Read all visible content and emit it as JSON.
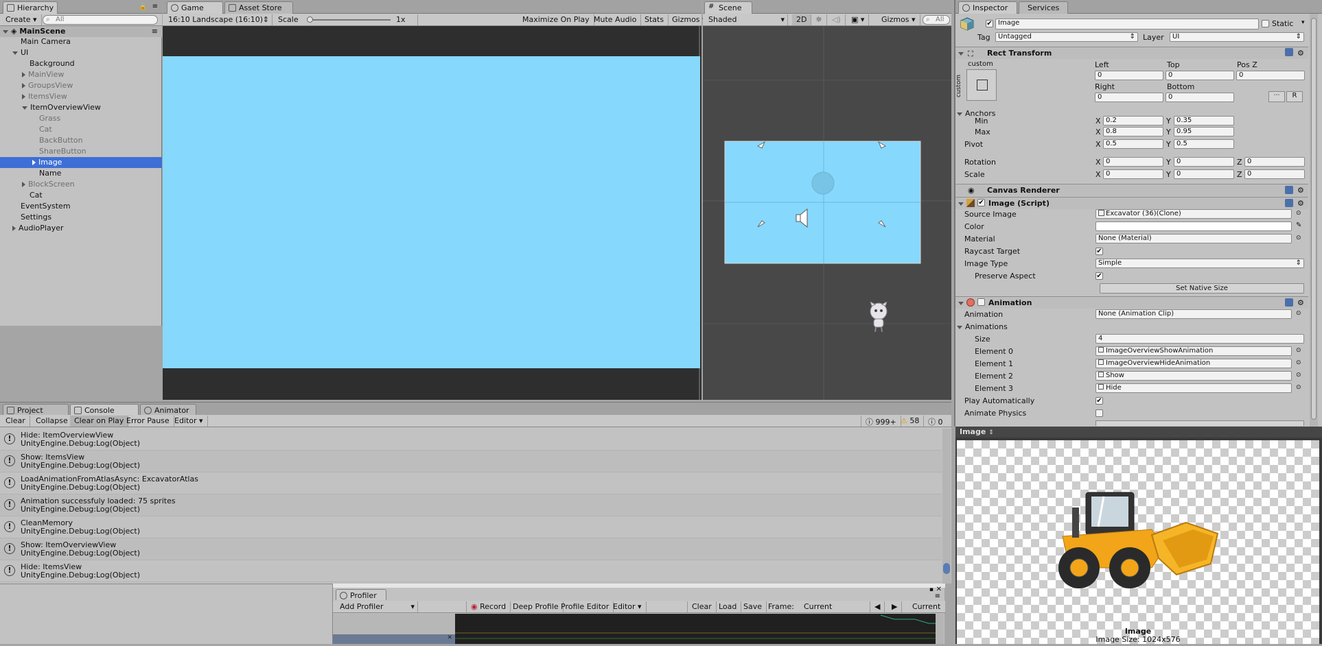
{
  "hierarchy": {
    "tab": "Hierarchy",
    "create_label": "Create",
    "search_placeholder": "All",
    "scene": "MainScene",
    "items": [
      {
        "label": "Main Camera"
      },
      {
        "label": "UI"
      },
      {
        "label": "Background"
      },
      {
        "label": "MainView"
      },
      {
        "label": "GroupsView"
      },
      {
        "label": "ItemsView"
      },
      {
        "label": "ItemOverviewView"
      },
      {
        "label": "Grass"
      },
      {
        "label": "Cat"
      },
      {
        "label": "BackButton"
      },
      {
        "label": "ShareButton"
      },
      {
        "label": "Image"
      },
      {
        "label": "Name"
      },
      {
        "label": "BlockScreen"
      },
      {
        "label": "Cat"
      },
      {
        "label": "EventSystem"
      },
      {
        "label": "Settings"
      },
      {
        "label": "AudioPlayer"
      }
    ]
  },
  "game": {
    "tab_game": "Game",
    "tab_asset_store": "Asset Store",
    "resolution": "16:10 Landscape (16:10)",
    "scale_label": "Scale",
    "scale_value": "1x",
    "maximize": "Maximize On Play",
    "mute": "Mute Audio",
    "stats": "Stats",
    "gizmos": "Gizmos",
    "viewport_color": "#87d8fd"
  },
  "scene": {
    "tab": "Scene",
    "shading": "Shaded",
    "mode_2d": "2D",
    "gizmos": "Gizmos",
    "search_placeholder": "All"
  },
  "inspector": {
    "tab": "Inspector",
    "tab_services": "Services",
    "object_name": "Image",
    "static_label": "Static",
    "tag_label": "Tag",
    "tag_value": "Untagged",
    "layer_label": "Layer",
    "layer_value": "UI",
    "rect_transform": {
      "title": "Rect Transform",
      "anchor_preset": "custom",
      "anchor_side": "custom",
      "left_label": "Left",
      "left": "0",
      "top_label": "Top",
      "top": "0",
      "posz_label": "Pos Z",
      "posz": "0",
      "right_label": "Right",
      "right": "0",
      "bottom_label": "Bottom",
      "bottom": "0",
      "r_button": "R",
      "anchors_label": "Anchors",
      "min_label": "Min",
      "min_x": "0.2",
      "min_y": "0.35",
      "max_label": "Max",
      "max_x": "0.8",
      "max_y": "0.95",
      "pivot_label": "Pivot",
      "pivot_x": "0.5",
      "pivot_y": "0.5",
      "rotation_label": "Rotation",
      "rot_x": "0",
      "rot_y": "0",
      "rot_z": "0",
      "scale_label": "Scale",
      "scale_x": "0",
      "scale_y": "0",
      "scale_z": "0",
      "x": "X",
      "y": "Y",
      "z": "Z"
    },
    "canvas_renderer": "Canvas Renderer",
    "image_script": {
      "title": "Image (Script)",
      "source_label": "Source Image",
      "source": "Excavator (36)(Clone)",
      "color_label": "Color",
      "material_label": "Material",
      "material": "None (Material)",
      "raycast_label": "Raycast Target",
      "type_label": "Image Type",
      "type": "Simple",
      "preserve_label": "Preserve Aspect",
      "native_button": "Set Native Size"
    },
    "animation": {
      "title": "Animation",
      "anim_label": "Animation",
      "anim_value": "None (Animation Clip)",
      "anims_label": "Animations",
      "size_label": "Size",
      "size": "4",
      "elements": [
        {
          "label": "Element 0",
          "value": "ImageOverviewShowAnimation"
        },
        {
          "label": "Element 1",
          "value": "ImageOverviewHideAnimation"
        },
        {
          "label": "Element 2",
          "value": "Show"
        },
        {
          "label": "Element 3",
          "value": "Hide"
        }
      ],
      "play_auto_label": "Play Automatically",
      "physics_label": "Animate Physics"
    }
  },
  "preview": {
    "title": "Image",
    "caption": "Image",
    "size": "Image Size: 1024x576"
  },
  "console": {
    "tab_project": "Project",
    "tab_console": "Console",
    "tab_animator": "Animator",
    "clear": "Clear",
    "collapse": "Collapse",
    "clear_on_play": "Clear on Play",
    "error_pause": "Error Pause",
    "editor": "Editor",
    "count_log": "999+",
    "count_warn": "58",
    "count_err": "0",
    "logs": [
      {
        "line1": "Hide: ItemOverviewView",
        "line2": "UnityEngine.Debug:Log(Object)"
      },
      {
        "line1": "Show: ItemsView",
        "line2": "UnityEngine.Debug:Log(Object)"
      },
      {
        "line1": "LoadAnimationFromAtlasAsync: ExcavatorAtlas",
        "line2": "UnityEngine.Debug:Log(Object)"
      },
      {
        "line1": "Animation successfuly loaded: 75 sprites",
        "line2": "UnityEngine.Debug:Log(Object)"
      },
      {
        "line1": "CleanMemory",
        "line2": "UnityEngine.Debug:Log(Object)"
      },
      {
        "line1": "Show: ItemOverviewView",
        "line2": "UnityEngine.Debug:Log(Object)"
      },
      {
        "line1": "Hide: ItemsView",
        "line2": "UnityEngine.Debug:Log(Object)"
      }
    ]
  },
  "profiler": {
    "tab": "Profiler",
    "add": "Add Profiler",
    "record": "Record",
    "deep": "Deep Profile",
    "editor_profile": "Profile Editor",
    "editor": "Editor",
    "clear": "Clear",
    "load": "Load",
    "save": "Save",
    "frame_label": "Frame:",
    "frame_value": "Current",
    "current_button": "Current"
  }
}
